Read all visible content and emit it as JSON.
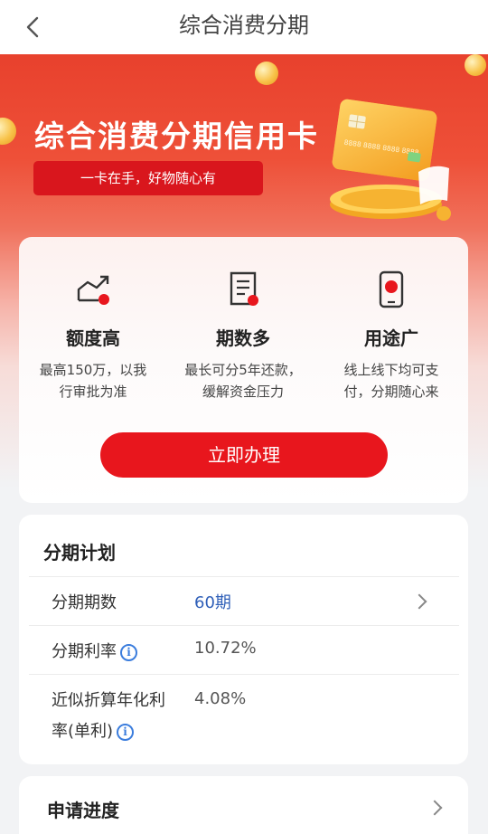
{
  "nav": {
    "title": "综合消费分期"
  },
  "hero": {
    "title": "综合消费分期信用卡",
    "slogan": "一卡在手，好物随心有",
    "card_number": "8888 8888 8888 8888"
  },
  "features": [
    {
      "icon": "trend-up-icon",
      "title": "额度高",
      "desc": [
        "最高150万，以我",
        "行审批为准"
      ]
    },
    {
      "icon": "document-list-icon",
      "title": "期数多",
      "desc": [
        "最长可分5年还款，",
        "缓解资金压力"
      ]
    },
    {
      "icon": "phone-payment-icon",
      "title": "用途广",
      "desc": [
        "线上线下均可支",
        "付，分期随心来"
      ]
    }
  ],
  "apply_button": "立即办理",
  "plan": {
    "heading": "分期计划",
    "rows": [
      {
        "label": "分期期数",
        "value": "60期"
      },
      {
        "label": "分期利率",
        "value": "10.72%"
      },
      {
        "label_lines": [
          "近似折算年化利",
          "率(单利)"
        ],
        "value": "4.08%"
      }
    ]
  },
  "progress": {
    "label": "申请进度"
  },
  "colors": {
    "brand_red": "#e8161d",
    "link_blue": "#2f5fb8",
    "info_blue": "#3b7ddd"
  }
}
